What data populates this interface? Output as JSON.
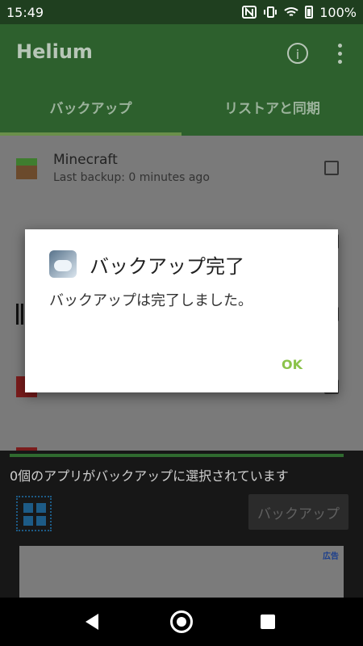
{
  "status_bar": {
    "time": "15:49",
    "battery": "100%"
  },
  "app_bar": {
    "title": "Helium",
    "info_icon": "i"
  },
  "tabs": [
    {
      "label": "バックアップ"
    },
    {
      "label": "リストアと同期"
    }
  ],
  "list": {
    "items": [
      {
        "name": "Minecraft",
        "subtitle": "Last backup: 0 minutes ago"
      }
    ]
  },
  "bottom_panel": {
    "selection_text": "0個のアプリがバックアップに選択されています",
    "backup_button": "バックアップ",
    "ad_label": "広告"
  },
  "dialog": {
    "title": "バックアップ完了",
    "message": "バックアップは完了しました。",
    "ok_button": "OK"
  },
  "colors": {
    "app_bar": "#2d602d",
    "dialog_ok": "#8bc34a",
    "grid_icon": "#1d5b86"
  }
}
